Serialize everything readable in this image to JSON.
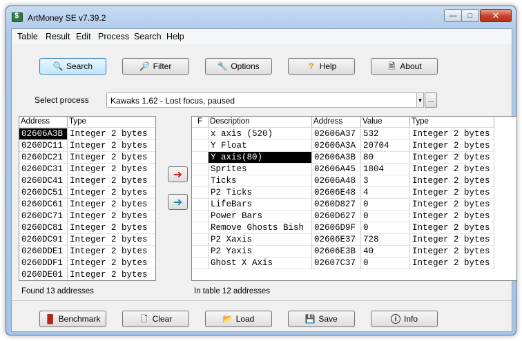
{
  "window": {
    "title": "ArtMoney SE v7.39.2"
  },
  "menu": [
    "Table",
    "Result",
    "Edit",
    "Process",
    "Search",
    "Help"
  ],
  "toolbar": {
    "search": "Search",
    "filter": "Filter",
    "options": "Options",
    "help": "Help",
    "about": "About"
  },
  "process": {
    "label": "Select process",
    "value": "Kawaks 1.62 - Lost focus, paused",
    "browse": "..."
  },
  "left_table": {
    "columns": [
      "Address",
      "Type"
    ],
    "rows": [
      {
        "address": "02606A3B",
        "type": "Integer 2 bytes",
        "selected": true
      },
      {
        "address": "0260DC11",
        "type": "Integer 2 bytes"
      },
      {
        "address": "0260DC21",
        "type": "Integer 2 bytes"
      },
      {
        "address": "0260DC31",
        "type": "Integer 2 bytes"
      },
      {
        "address": "0260DC41",
        "type": "Integer 2 bytes"
      },
      {
        "address": "0260DC51",
        "type": "Integer 2 bytes"
      },
      {
        "address": "0260DC61",
        "type": "Integer 2 bytes"
      },
      {
        "address": "0260DC71",
        "type": "Integer 2 bytes"
      },
      {
        "address": "0260DC81",
        "type": "Integer 2 bytes"
      },
      {
        "address": "0260DC91",
        "type": "Integer 2 bytes"
      },
      {
        "address": "0260DDE1",
        "type": "Integer 2 bytes"
      },
      {
        "address": "0260DDF1",
        "type": "Integer 2 bytes"
      },
      {
        "address": "0260DE01",
        "type": "Integer 2 bytes"
      }
    ],
    "status": "Found 13 addresses"
  },
  "right_table": {
    "columns": [
      "F",
      "Description",
      "Address",
      "Value",
      "Type"
    ],
    "rows": [
      {
        "f": "",
        "description": "x axis (520)",
        "address": "02606A37",
        "value": "532",
        "type": "Integer 2 bytes"
      },
      {
        "f": "",
        "description": "Y Float",
        "address": "02606A3A",
        "value": "20704",
        "type": "Integer 2 bytes"
      },
      {
        "f": "",
        "description": "Y axis(80)",
        "address": "02606A3B",
        "value": "80",
        "type": "Integer 2 bytes",
        "selected": true
      },
      {
        "f": "",
        "description": "Sprites",
        "address": "02606A45",
        "value": "1804",
        "type": "Integer 2 bytes"
      },
      {
        "f": "",
        "description": "Ticks",
        "address": "02606A48",
        "value": "3",
        "type": "Integer 2 bytes"
      },
      {
        "f": "",
        "description": "P2 Ticks",
        "address": "02606E48",
        "value": "4",
        "type": "Integer 2 bytes"
      },
      {
        "f": "",
        "description": "LifeBars",
        "address": "0260D827",
        "value": "0",
        "type": "Integer 2 bytes"
      },
      {
        "f": "",
        "description": "Power Bars",
        "address": "0260D627",
        "value": "0",
        "type": "Integer 2 bytes"
      },
      {
        "f": "",
        "description": "Remove Ghosts Bish",
        "address": "02606D9F",
        "value": "0",
        "type": "Integer 2 bytes"
      },
      {
        "f": "",
        "description": "P2 Xaxis",
        "address": "02606E37",
        "value": "728",
        "type": "Integer 2 bytes"
      },
      {
        "f": "",
        "description": "P2 Yaxis",
        "address": "02606E3B",
        "value": "40",
        "type": "Integer 2 bytes"
      },
      {
        "f": "",
        "description": "Ghost X Axis",
        "address": "02607C37",
        "value": "0",
        "type": "Integer 2 bytes"
      }
    ],
    "status": "In table 12 addresses"
  },
  "bottom": {
    "benchmark": "Benchmark",
    "clear": "Clear",
    "load": "Load",
    "save": "Save",
    "info": "Info"
  },
  "colors": {
    "selection": "#000000",
    "add_arrow": "#d21f1f",
    "remove_arrow": "#1a8a9a"
  }
}
